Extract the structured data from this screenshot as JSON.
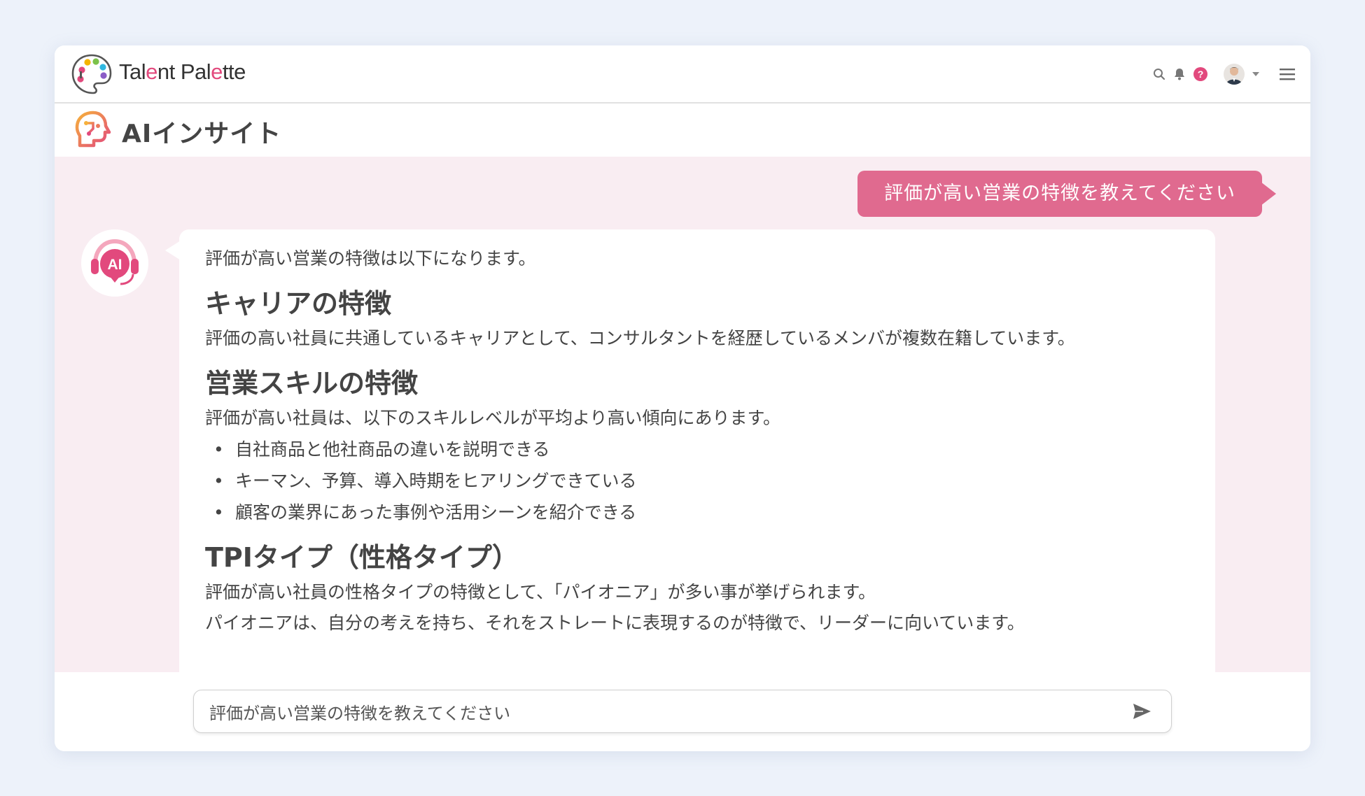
{
  "app": {
    "brand_part1": "Tal",
    "brand_part2": "e",
    "brand_part3": "nt Pal",
    "brand_part4": "e",
    "brand_part5": "tte",
    "section_title": "AIインサイト"
  },
  "header_icons": [
    "search-icon",
    "bell-icon",
    "help-icon",
    "avatar",
    "chevron-down-icon",
    "menu-icon"
  ],
  "help_glyph": "?",
  "ai_badge": "AI",
  "user_message": "評価が高い営業の特徴を教えてください",
  "ai_response": {
    "intro": "評価が高い営業の特徴は以下になります。",
    "sections": [
      {
        "heading": "キャリアの特徴",
        "lines": [
          "評価の高い社員に共通しているキャリアとして、コンサルタントを経歴しているメンバが複数在籍しています。"
        ]
      },
      {
        "heading": "営業スキルの特徴",
        "lines": [
          "評価が高い社員は、以下のスキルレベルが平均より高い傾向にあります。"
        ],
        "bullets": [
          "自社商品と他社商品の違いを説明できる",
          "キーマン、予算、導入時期をヒアリングできている",
          "顧客の業界にあった事例や活用シーンを紹介できる"
        ]
      },
      {
        "heading": "TPIタイプ（性格タイプ）",
        "lines": [
          "評価が高い社員の性格タイプの特徴として、「パイオニア」が多い事が挙げられます。",
          "パイオニアは、自分の考えを持ち、それをストレートに表現するのが特徴で、リーダーに向いています。"
        ]
      }
    ]
  },
  "composer": {
    "value": "評価が高い営業の特徴を教えてください",
    "placeholder": "評価が高い営業の特徴を教えてください"
  },
  "colors": {
    "accent_pink": "#e06a8f",
    "chat_bg": "#f9edf2",
    "page_bg": "#edf2fa"
  }
}
